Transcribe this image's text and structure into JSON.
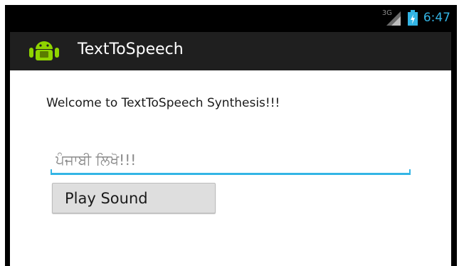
{
  "status_bar": {
    "network_label": "3G",
    "time": "6:47",
    "icons": [
      "signal-icon",
      "battery-icon"
    ],
    "accent_color": "#33b5e5"
  },
  "action_bar": {
    "app_icon": "android-icon",
    "title": "TextToSpeech"
  },
  "main": {
    "welcome_text": "Welcome to TextToSpeech Synthesis!!!",
    "input": {
      "value": "ਪੰਜਾਬੀ ਲਿਖੋ!!!",
      "underline_color": "#33b5e5"
    },
    "play_button_label": "Play Sound"
  }
}
